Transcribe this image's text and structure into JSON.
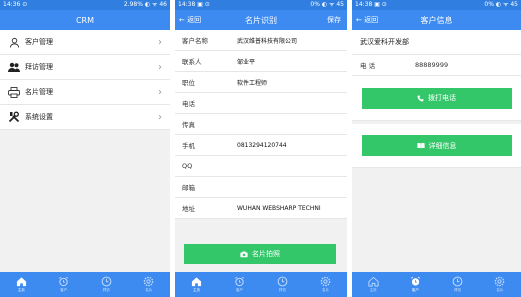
{
  "screen1": {
    "status_left": "14:36 ⊙",
    "status_right": "2.98% ◐ ᯤ 46",
    "title": "CRM",
    "menu": [
      {
        "label": "客户管理",
        "icon": "user-icon"
      },
      {
        "label": "拜访管理",
        "icon": "users-icon"
      },
      {
        "label": "名片管理",
        "icon": "printer-icon"
      },
      {
        "label": "系统设置",
        "icon": "tools-icon"
      }
    ],
    "tabs": [
      "主页",
      "客户",
      "拜访",
      "名片"
    ]
  },
  "screen2": {
    "status_left": "14:38 ▣ ⊙",
    "status_right": "0% ◐ ᯤ 45",
    "back": "← 返回",
    "title": "名片识别",
    "save": "保存",
    "fields": [
      {
        "k": "客户名称",
        "v": "武汉维普科技有限公司"
      },
      {
        "k": "联系人",
        "v": "邹业平"
      },
      {
        "k": "职位",
        "v": "软件工程师"
      },
      {
        "k": "电话",
        "v": ""
      },
      {
        "k": "传真",
        "v": ""
      },
      {
        "k": "手机",
        "v": "0813294120744"
      },
      {
        "k": "QQ",
        "v": ""
      },
      {
        "k": "邮箱",
        "v": ""
      },
      {
        "k": "地址",
        "v": "WUHAN WEBSHARP TECHNI"
      }
    ],
    "button": "名片拍照",
    "tabs": [
      "主页",
      "客户",
      "拜访",
      "名片"
    ]
  },
  "screen3": {
    "status_left": "14:38 ▣ ⊙",
    "status_right": "0% ◐ ᯤ 45",
    "back": "← 返回",
    "title": "客户信息",
    "company": "武汉爱科开发部",
    "phone_label": "电 话",
    "phone_value": "88889999",
    "call_button": "拨打电话",
    "detail_button": "详细信息",
    "tabs": [
      "主页",
      "客户",
      "拜访",
      "名片"
    ]
  },
  "colors": {
    "primary": "#3d8bf1",
    "status": "#2f7ee0",
    "green": "#34c76a"
  }
}
